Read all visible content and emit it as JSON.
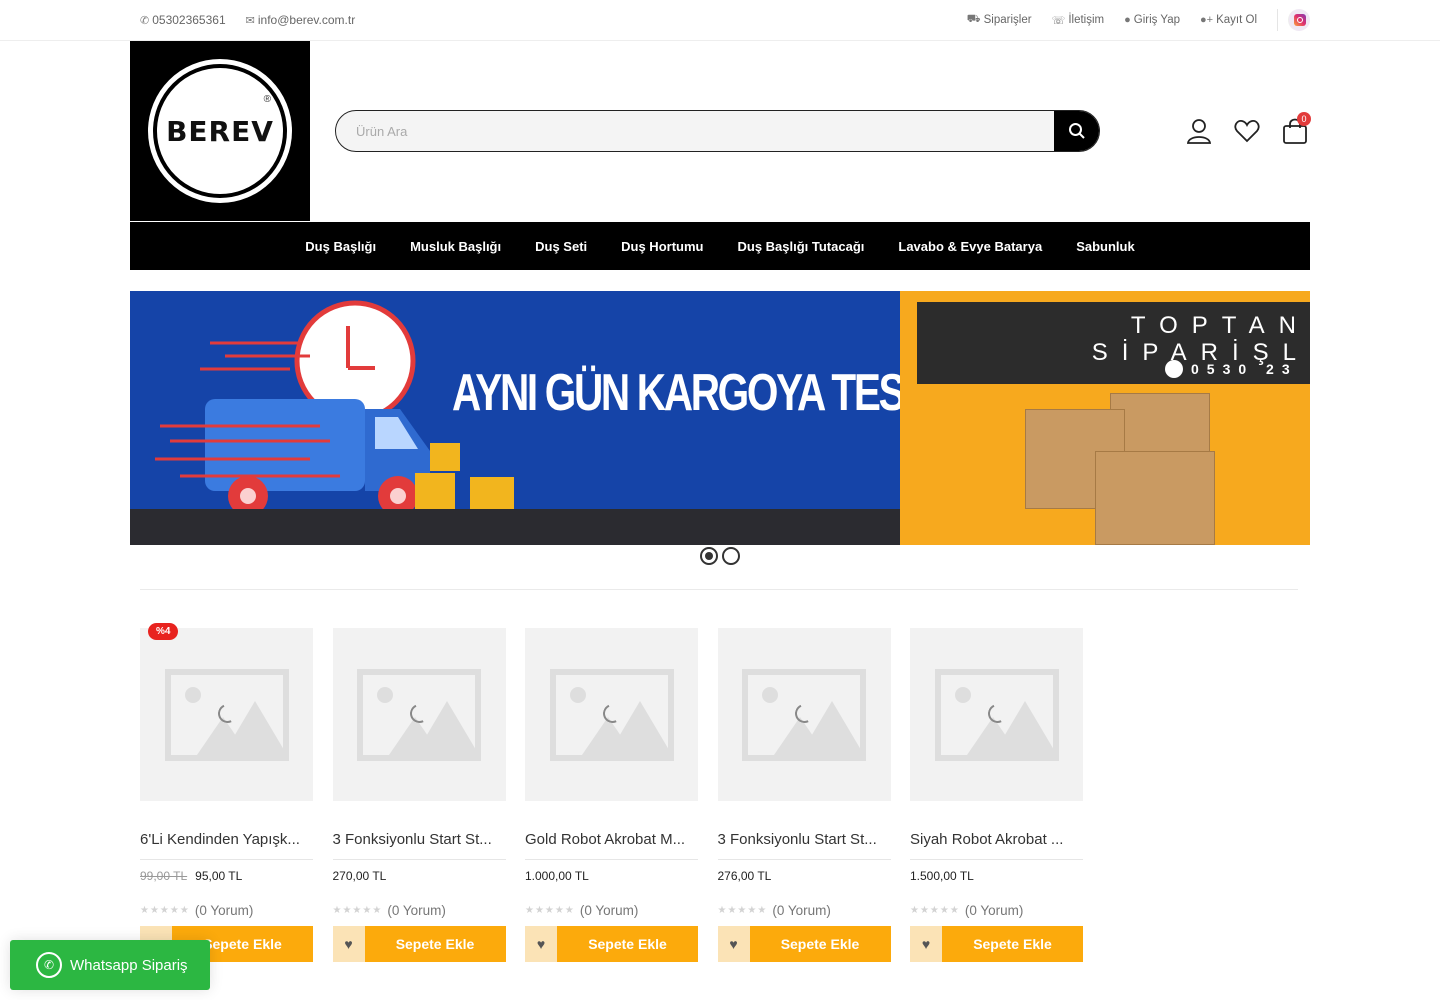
{
  "topbar": {
    "phone": "05302365361",
    "email": "info@berev.com.tr",
    "links": [
      {
        "label": "Siparişler",
        "icon": "truck-icon"
      },
      {
        "label": "İletişim",
        "icon": "contact-icon"
      },
      {
        "label": "Giriş Yap",
        "icon": "user-circle-icon"
      },
      {
        "label": "Kayıt Ol",
        "icon": "user-plus-icon"
      }
    ]
  },
  "header": {
    "logo_text": "BEREV",
    "logo_reg": "®",
    "search_placeholder": "Ürün Ara",
    "cart_count": "0"
  },
  "nav": {
    "items": [
      "Duş Başlığı",
      "Musluk Başlığı",
      "Duş Seti",
      "Duş Hortumu",
      "Duş Başlığı Tutacağı",
      "Lavabo & Evye Batarya",
      "Sabunluk"
    ]
  },
  "banner": {
    "headline": "AYNI GÜN KARGOYA TESLİM",
    "right_line1": "TOPTAN",
    "right_line2": "SİPARİŞL",
    "right_phone": "0530 23",
    "slides": 2,
    "active_slide": 1
  },
  "products": [
    {
      "title": "6'Li Kendinden Yapışk...",
      "old_price": "99,00 TL",
      "price": "95,00 TL",
      "badge": "%4",
      "reviews": "(0 Yorum)",
      "cart_label": "Sepete Ekle"
    },
    {
      "title": "3 Fonksiyonlu Start St...",
      "old_price": "",
      "price": "270,00 TL",
      "badge": "",
      "reviews": "(0 Yorum)",
      "cart_label": "Sepete Ekle"
    },
    {
      "title": "Gold Robot Akrobat M...",
      "old_price": "",
      "price": "1.000,00 TL",
      "badge": "",
      "reviews": "(0 Yorum)",
      "cart_label": "Sepete Ekle"
    },
    {
      "title": "3 Fonksiyonlu Start St...",
      "old_price": "",
      "price": "276,00 TL",
      "badge": "",
      "reviews": "(0 Yorum)",
      "cart_label": "Sepete Ekle"
    },
    {
      "title": "Siyah Robot Akrobat ...",
      "old_price": "",
      "price": "1.500,00 TL",
      "badge": "",
      "reviews": "(0 Yorum)",
      "cart_label": "Sepete Ekle"
    }
  ],
  "whatsapp": {
    "label": "Whatsapp Sipariş"
  },
  "colors": {
    "accent": "#fcaa0c",
    "whatsapp": "#2cb742",
    "banner_blue": "#1544a8",
    "banner_orange": "#f7a91e",
    "badge": "#e8231f"
  }
}
